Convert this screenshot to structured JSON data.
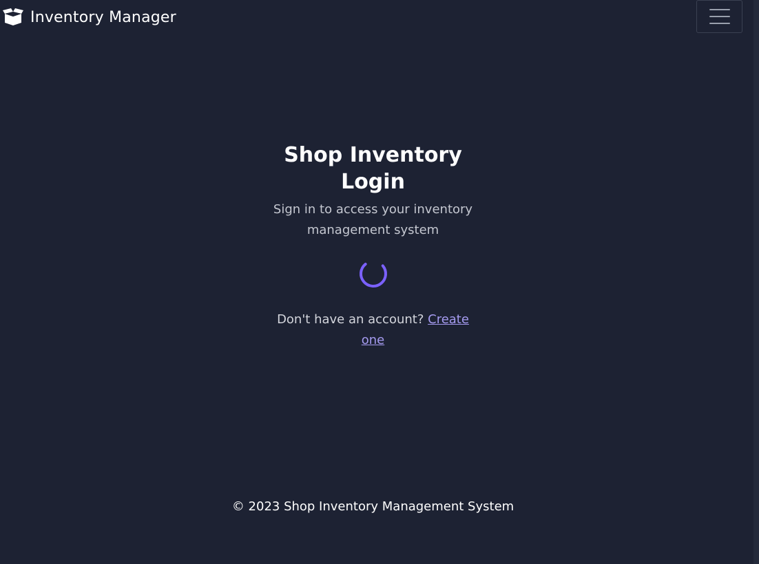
{
  "navbar": {
    "brand_icon": "open-box-icon",
    "brand_text": "Inventory Manager",
    "toggler_icon": "hamburger-menu-icon"
  },
  "login": {
    "title": "Shop Inventory Login",
    "subtitle": "Sign in to access your inventory management system",
    "spinner_icon": "loading-spinner-icon",
    "account_prompt": "Don't have an account?",
    "create_link_text": "Create one"
  },
  "footer": {
    "text": "© 2023 Shop Inventory Management System"
  },
  "colors": {
    "background": "#1d2233",
    "accent": "#7b61ff",
    "link": "#a59bf0",
    "muted_text": "#c4c7d0"
  }
}
